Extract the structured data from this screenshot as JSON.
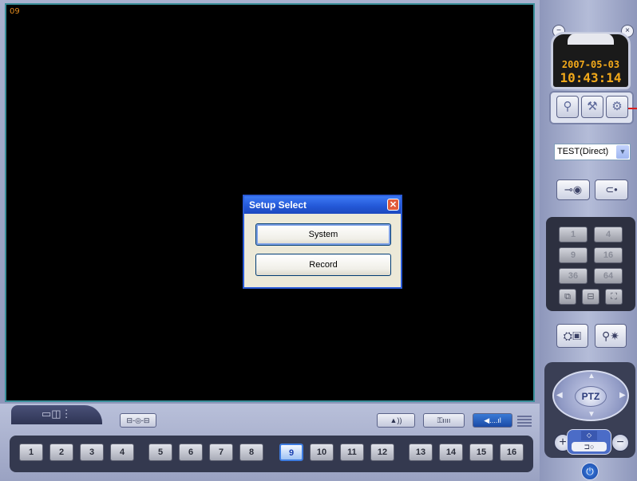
{
  "video": {
    "camera_label": "09"
  },
  "dialog": {
    "title": "Setup Select",
    "close_glyph": "✕",
    "buttons": [
      "System",
      "Record"
    ]
  },
  "clock": {
    "date": "2007-05-03",
    "time": "10:43:14"
  },
  "right_panel": {
    "icons": [
      "search-icon",
      "wrench-icon",
      "gear-icon"
    ],
    "site_select": {
      "value": "TEST(Direct)",
      "arrow": "▼"
    },
    "connect_icons": [
      "connect-icon",
      "disconnect-icon"
    ],
    "split_buttons": [
      "1",
      "4",
      "9",
      "16",
      "36",
      "64"
    ],
    "layout_icons": [
      "sequence-icon",
      "single-icon",
      "fullscreen-icon"
    ],
    "extra_icons": [
      "backup-icon",
      "search-event-icon"
    ]
  },
  "ptz": {
    "label": "PTZ",
    "zoom_in": "+",
    "zoom_out": "−",
    "focus": "◇",
    "power": "⏻"
  },
  "bottom": {
    "tab_icon": "camera-view-icon",
    "network_icon_text": "⊟-◎-⊟",
    "alarm_icon_text": "▲))",
    "key_icon_text": "⚿ıııı",
    "audio_icon_text": "◀....ıl",
    "channels": [
      "1",
      "2",
      "3",
      "4",
      "5",
      "6",
      "7",
      "8",
      "9",
      "10",
      "11",
      "12",
      "13",
      "14",
      "15",
      "16"
    ],
    "active_channel": "9"
  },
  "colors": {
    "accent": "#2a5bd7",
    "clock_digits": "#f2a91a",
    "camera_label": "#e08a1e"
  }
}
